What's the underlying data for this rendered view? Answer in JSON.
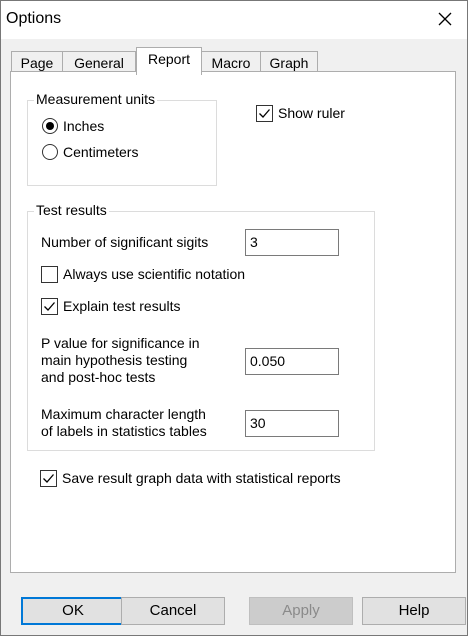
{
  "window": {
    "title": "Options"
  },
  "tabs": [
    {
      "label": "Page"
    },
    {
      "label": "General"
    },
    {
      "label": "Report",
      "active": true
    },
    {
      "label": "Macro"
    },
    {
      "label": "Graph"
    }
  ],
  "measurement": {
    "group_label": "Measurement units",
    "options": [
      {
        "label": "Inches",
        "selected": true
      },
      {
        "label": "Centimeters",
        "selected": false
      }
    ]
  },
  "show_ruler": {
    "label": "Show ruler",
    "checked": true
  },
  "test_results": {
    "group_label": "Test results",
    "significant_digits": {
      "label": "Number of significant sigits",
      "value": "3"
    },
    "scientific_notation": {
      "label": "Always use scientific notation",
      "checked": false
    },
    "explain": {
      "label": "Explain test results",
      "checked": true
    },
    "p_value": {
      "label_lines": [
        "P value for significance in",
        "main hypothesis testing",
        "and post-hoc tests"
      ],
      "value": "0.050"
    },
    "max_label_length": {
      "label_lines": [
        "Maximum character length",
        "of labels in statistics tables"
      ],
      "value": "30"
    }
  },
  "save_graph_data": {
    "label": "Save result graph data with statistical reports",
    "checked": true
  },
  "buttons": {
    "ok": "OK",
    "cancel": "Cancel",
    "apply": "Apply",
    "help": "Help"
  },
  "icons": {
    "close": "close-icon",
    "check": "checkmark-icon"
  }
}
